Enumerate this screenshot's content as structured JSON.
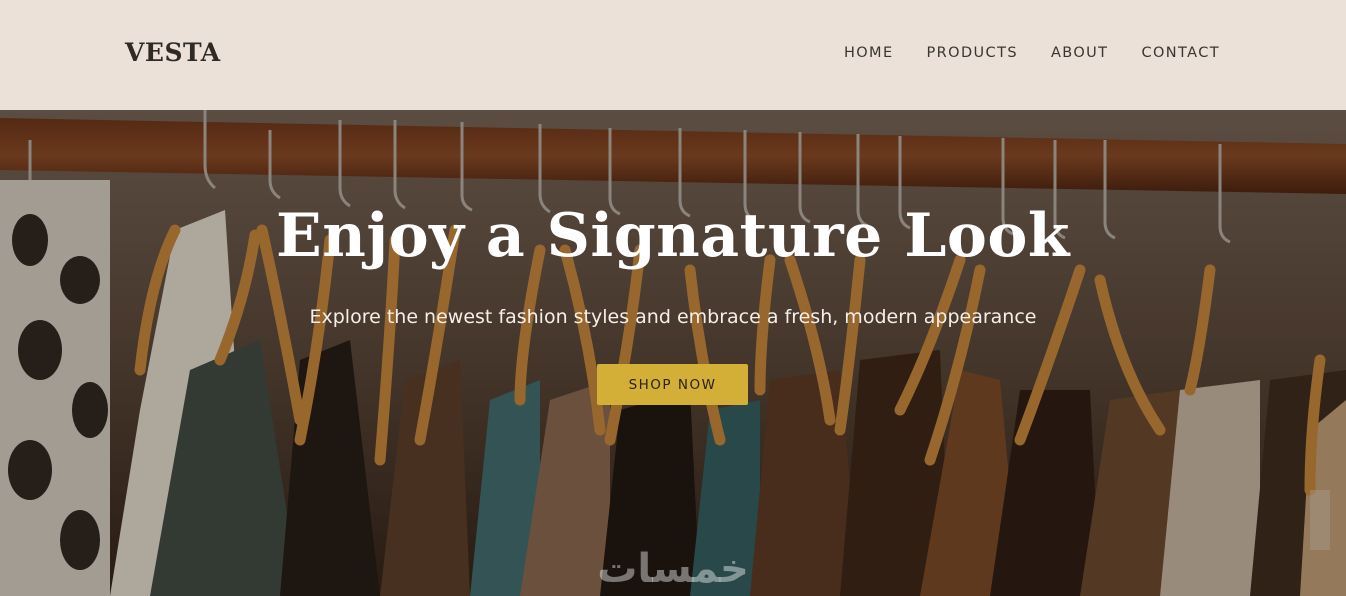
{
  "brand": {
    "name": "VESTA"
  },
  "nav": {
    "items": [
      "HOME",
      "PRODUCTS",
      "ABOUT",
      "CONTACT"
    ]
  },
  "hero": {
    "title": "Enjoy a Signature Look",
    "subtitle": "Explore the newest fashion styles and embrace a fresh, modern appearance",
    "cta_label": "SHOP NOW",
    "image_subject": "clothing-rack-with-wooden-hangers",
    "watermark": "خمسات"
  },
  "colors": {
    "header_bg": "#ebe1d8",
    "accent": "#d4af37",
    "text_dark": "#2f2a26",
    "hero_text": "#ffffff"
  }
}
